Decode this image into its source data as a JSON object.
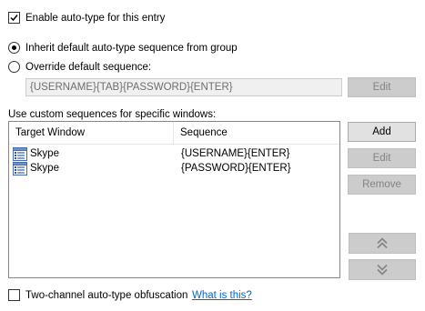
{
  "auto_type": {
    "enable_label": "Enable auto-type for this entry",
    "enable_checked": true,
    "inherit_label": "Inherit default auto-type sequence from group",
    "override_label": "Override default sequence:",
    "selected_option": "inherit",
    "default_sequence_value": "{USERNAME}{TAB}{PASSWORD}{ENTER}",
    "edit_sequence_label": "Edit"
  },
  "custom_sequences": {
    "section_label": "Use custom sequences for specific windows:",
    "columns": [
      "Target Window",
      "Sequence"
    ],
    "rows": [
      {
        "window": "Skype",
        "sequence": "{USERNAME}{ENTER}",
        "icon": "entry-list-icon"
      },
      {
        "window": "Skype",
        "sequence": "{PASSWORD}{ENTER}",
        "icon": "entry-list-icon"
      }
    ],
    "add_label": "Add",
    "edit_label": "Edit",
    "remove_label": "Remove",
    "move_up_icon": "double-chevron-up-icon",
    "move_down_icon": "double-chevron-down-icon"
  },
  "obfuscation": {
    "label": "Two-channel auto-type obfuscation",
    "checked": false,
    "help_link": "What is this?"
  },
  "colors": {
    "link": "#0066cc",
    "button_face": "#e1e1e1",
    "disabled_text": "#838383"
  }
}
